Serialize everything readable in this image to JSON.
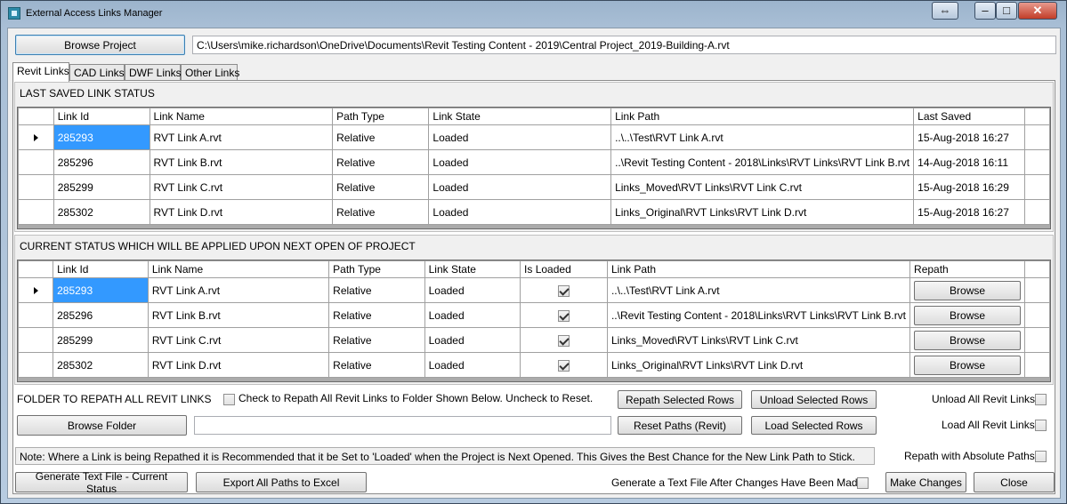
{
  "window": {
    "title": "External Access Links Manager"
  },
  "project": {
    "browse_label": "Browse Project",
    "path": "C:\\Users\\mike.richardson\\OneDrive\\Documents\\Revit Testing Content - 2019\\Central Project_2019-Building-A.rvt"
  },
  "tabs": [
    "Revit Links",
    "CAD Links",
    "DWF Links",
    "Other Links"
  ],
  "last_saved": {
    "title": "LAST SAVED LINK STATUS",
    "columns": [
      "Link Id",
      "Link Name",
      "Path Type",
      "Link State",
      "Link Path",
      "Last Saved"
    ],
    "rows": [
      [
        "285293",
        "RVT Link A.rvt",
        "Relative",
        "Loaded",
        "..\\..\\Test\\RVT Link A.rvt",
        "15-Aug-2018 16:27"
      ],
      [
        "285296",
        "RVT Link B.rvt",
        "Relative",
        "Loaded",
        "..\\Revit Testing Content - 2018\\Links\\RVT Links\\RVT Link B.rvt",
        "14-Aug-2018 16:11"
      ],
      [
        "285299",
        "RVT Link C.rvt",
        "Relative",
        "Loaded",
        "Links_Moved\\RVT Links\\RVT Link C.rvt",
        "15-Aug-2018 16:29"
      ],
      [
        "285302",
        "RVT Link D.rvt",
        "Relative",
        "Loaded",
        "Links_Original\\RVT Links\\RVT Link D.rvt",
        "15-Aug-2018 16:27"
      ]
    ]
  },
  "current": {
    "title": "CURRENT STATUS WHICH WILL BE APPLIED UPON NEXT OPEN OF PROJECT",
    "columns": [
      "Link Id",
      "Link Name",
      "Path Type",
      "Link State",
      "Is Loaded",
      "Link Path",
      "Repath"
    ],
    "browse_label": "Browse",
    "rows": [
      [
        "285293",
        "RVT Link A.rvt",
        "Relative",
        "Loaded",
        "..\\..\\Test\\RVT Link A.rvt"
      ],
      [
        "285296",
        "RVT Link B.rvt",
        "Relative",
        "Loaded",
        "..\\Revit Testing Content - 2018\\Links\\RVT Links\\RVT Link B.rvt"
      ],
      [
        "285299",
        "RVT Link C.rvt",
        "Relative",
        "Loaded",
        "Links_Moved\\RVT Links\\RVT Link C.rvt"
      ],
      [
        "285302",
        "RVT Link D.rvt",
        "Relative",
        "Loaded",
        "Links_Original\\RVT Links\\RVT Link D.rvt"
      ]
    ]
  },
  "repath": {
    "folder_heading": "FOLDER TO REPATH ALL REVIT LINKS",
    "check_label": "Check to Repath All Revit Links to Folder Shown Below. Uncheck to Reset.",
    "browse_folder": "Browse Folder",
    "folder_path": "",
    "repath_selected": "Repath Selected Rows",
    "unload_selected": "Unload Selected Rows",
    "reset_paths": "Reset Paths (Revit)",
    "load_selected": "Load Selected Rows",
    "unload_all": "Unload All Revit Links",
    "load_all": "Load All Revit Links",
    "absolute": "Repath with Absolute Paths"
  },
  "note": "Note: Where a Link is being Repathed it is Recommended that it be Set to 'Loaded' when the Project is Next Opened. This Gives the Best Chance for the New Link Path to Stick.",
  "footer": {
    "gen_text": "Generate Text File - Current Status",
    "export": "Export All Paths to Excel",
    "gen_after": "Generate a Text File After Changes Have Been Made",
    "make_changes": "Make Changes",
    "close": "Close"
  }
}
